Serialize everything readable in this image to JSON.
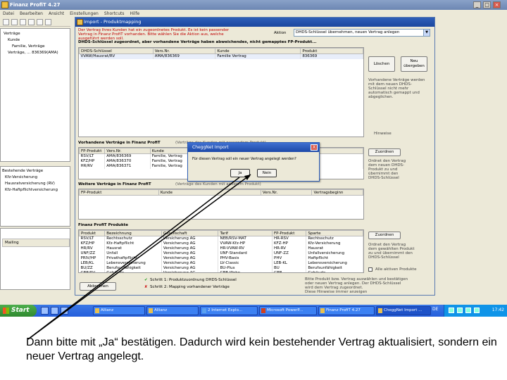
{
  "outer": {
    "title": "Finanz ProfiT 4.27",
    "menu": [
      "Datei",
      "Bearbeiten",
      "Ansicht",
      "Einstellungen",
      "Shortcuts",
      "Hilfe"
    ],
    "tree": [
      "Verträge",
      "Kunde",
      "Familie, Verträge",
      "Verträge, ... 836369(AMA)"
    ],
    "tree2": [
      "Bestehende Verträge",
      "Kfz-Versicherung",
      "Hausratversicherung (RV)",
      "Kfz-Haftpflichtversicherung"
    ],
    "lp3_label": "Mailing"
  },
  "import_dialog": {
    "title": "Import - Produktmapping",
    "info_lines": [
      "Der Vertrag Ihres Kunden hat ein zugeordnetes Produkt. Es ist kein passender",
      "Vertrag in Finanz ProfiT vorhanden. Bitte wählen Sie die Aktion aus, welche",
      "ausgeführt werden soll."
    ],
    "aktion_label": "Aktion",
    "aktion_value": "DHDS-Schlüssel übernehmen, neuen Vertrag anlegen",
    "section1": "DHDS-Schlüssel zugeordnet, aber vorhandene Verträge haben abweichendes, nicht gemapptes FP-Produkt...",
    "grid1": {
      "columns": [
        "DHDS-Schlüssel",
        "Vers.Nr.",
        "Kunde",
        "Produkt"
      ],
      "rows": [
        [
          "VVAW/Hausrat/RV",
          "AMA/836369",
          "Familie Vertrag",
          "836369"
        ]
      ]
    },
    "btn_loeschen": "Löschen",
    "btn_uebergeben": "Neu übergeben",
    "right_text1": [
      "Vorhandene Verträge werden",
      "mit dem neuen DHDS-",
      "Schlüssel nicht mehr",
      "automatisch gemappt und",
      "abgeglichen."
    ],
    "right_text1b": "Hinweise",
    "section2": "Vorhandene Verträge in Finanz ProfiT",
    "section2_note": "(Verträge des Kunden mit passendem Produkt)",
    "grid2": {
      "columns": [
        "FP-Produkt",
        "Vers.Nr.",
        "Kunde",
        "Vertragsbeginn"
      ],
      "rows": [
        [
          "RSV/LT",
          "AMA/836369",
          "Familie, Vertrag",
          "01.01.2009"
        ],
        [
          "KFZ/HP",
          "AMA/836370",
          "Familie, Vertrag",
          "01.01.2009"
        ],
        [
          "HR/RV",
          "AMA/836371",
          "Familie, Vertrag",
          "01.01.2009"
        ]
      ]
    },
    "btn_zuordnen1": "Zuordnen",
    "right_text2": [
      "Ordnet den Vertrag",
      "dem neuen DHDS-",
      "Produkt zu und",
      "übernimmt den",
      "DHDS-Schlüssel"
    ],
    "section3": "Weitere Verträge in Finanz ProfiT",
    "section3_note": "(Verträge des Kunden mit anderem Produkt)",
    "grid3": {
      "columns": [
        "FP-Produkt",
        "Kunde",
        "Vers.Nr.",
        "Vertragsbeginn"
      ],
      "rows": []
    },
    "section4": "Finanz ProfiT Produkte",
    "grid4": {
      "columns": [
        "Produkt",
        "Bezeichnung",
        "Gesellschaft",
        "Tarif",
        "FP-Produkt",
        "Sparte"
      ],
      "rows": [
        [
          "RSV/LT",
          "Rechtsschutz",
          "Versicherung AG",
          "NEB/RSV-MAT",
          "HR-RSV",
          "Rechtsschutz"
        ],
        [
          "KFZ/HP",
          "Kfz-Haftpflicht",
          "Versicherung AG",
          "VVAW-Kfz-HP",
          "KFZ-HP",
          "Kfz-Versicherung"
        ],
        [
          "HR/RV",
          "Hausrat",
          "Versicherung AG",
          "HR-VVAW-RV",
          "HR-RV",
          "Hausrat"
        ],
        [
          "UNF/ZZ",
          "Unfall",
          "Versicherung AG",
          "UNF-Standard",
          "UNF-ZZ",
          "Unfallversicherung"
        ],
        [
          "PRIV/HP",
          "Privathaftpflicht",
          "Versicherung AG",
          "PHV-Basis",
          "PHV",
          "Haftpflicht"
        ],
        [
          "LEB/KL",
          "Lebensversicherung",
          "Versicherung AG",
          "LV-Classic",
          "LEB-KL",
          "Lebensversicherung"
        ],
        [
          "BU/ZZ",
          "Berufsunfähigkeit",
          "Versicherung AG",
          "BU-Plus",
          "BU",
          "Berufsunfähigkeit"
        ],
        [
          "GEB/RV",
          "Gebäude",
          "Versicherung AG",
          "GEB-Wohn",
          "GEB",
          "Gebäude"
        ]
      ]
    },
    "btn_zuordnen2": "Zuordnen",
    "right_text3": [
      "Ordnet den Vertrag",
      "dem gewählten Produkt",
      "zu und übernimmt den",
      "DHDS-Schlüssel"
    ],
    "chk_label": "Alle aktiven Produkte",
    "btn_abbrechen": "Abbrechen",
    "step1": "Schritt 1: Produktzuordnung DHDS-Schlüssel",
    "step2": "Schritt 2: Mapping vorhandener Verträge",
    "step_mark1": "✔",
    "step_mark2": "✘",
    "bottom_right": [
      "Bitte Produkt bzw. Vertrag auswählen und bestätigen",
      "oder neuen Vertrag anlegen. Der DHDS-Schlüssel",
      "wird dem Vertrag zugeordnet.",
      "Diese Hinweise immer anzeigen"
    ]
  },
  "cheggnet": {
    "title": "CheggNet Import",
    "message": "Für diesen Vertrag soll ein neuer Vertrag angelegt werden?",
    "yes": "Ja",
    "no": "Nein",
    "close": "X"
  },
  "taskbar": {
    "start": "Start",
    "tasks": [
      "Allianz",
      "Allianz",
      "2 Internet Explo...",
      "Microsoft PowerP...",
      "Finanz ProfiT 4.27",
      "CheggNet Import ..."
    ],
    "lang": "DE",
    "clock": "17:42"
  },
  "caption": "Dann bitte mit „Ja“ bestätigen. Dadurch wird kein bestehender Vertrag aktualisiert, sondern ein neuer Vertrag angelegt."
}
